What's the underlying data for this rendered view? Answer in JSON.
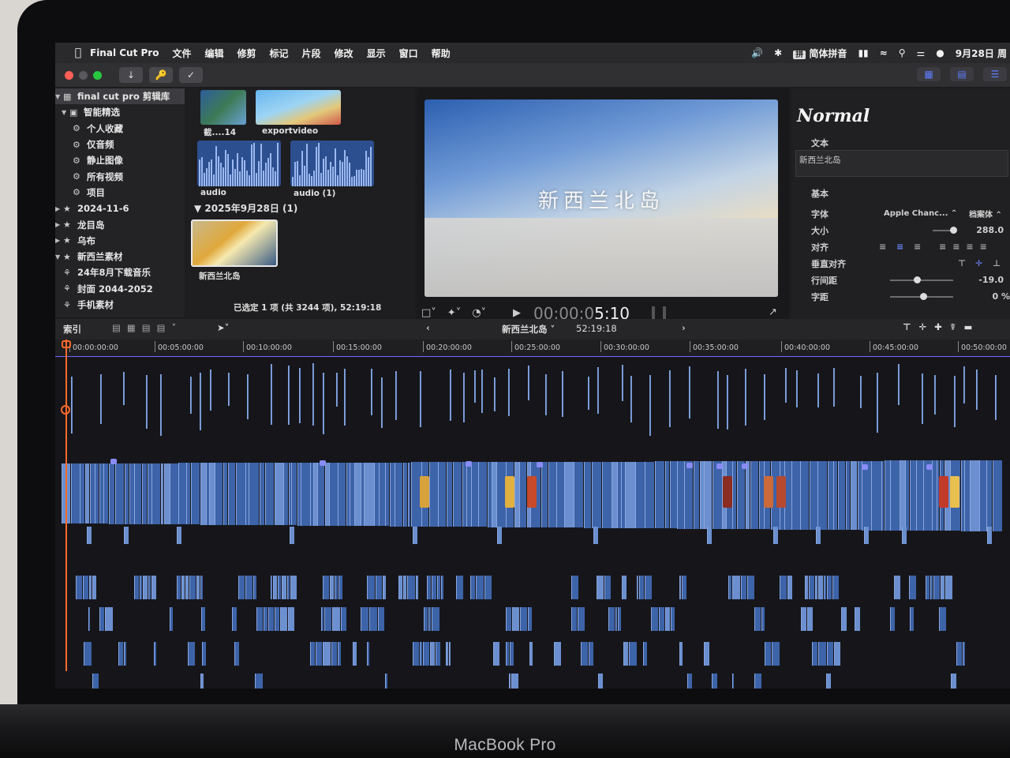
{
  "device": {
    "brand": "MacBook Pro"
  },
  "menubar": {
    "app_name": "Final Cut Pro",
    "items": [
      "文件",
      "编辑",
      "修剪",
      "标记",
      "片段",
      "修改",
      "显示",
      "窗口",
      "帮助"
    ],
    "input_method_badge": "拼",
    "input_method": "简体拼音",
    "date": "9月28日 周"
  },
  "sidebar": {
    "library": "final cut pro 剪辑库",
    "smart_collections_label": "智能精选",
    "smart_items": [
      "个人收藏",
      "仅音频",
      "静止图像",
      "所有视频",
      "项目"
    ],
    "events": [
      "2024-11-6",
      "龙目岛",
      "乌布",
      "新西兰素材"
    ],
    "sub_items": [
      "24年8月下载音乐",
      "封面 2044-2052",
      "手机素材"
    ]
  },
  "browser": {
    "clip_labels": [
      "截....14",
      "exportvideo",
      "audio",
      "audio (1)"
    ],
    "date_group": "2025年9月28日",
    "date_group_count": "(1)",
    "project_label": "新西兰北岛",
    "status": "已选定 1 项 (共 3244 项), 52:19:18"
  },
  "viewer": {
    "overlay_title": "新西兰北岛",
    "timecode_dim": "00:00:0",
    "timecode": "5:10"
  },
  "inspector": {
    "title": "Normal",
    "section_text": "文本",
    "text_value": "新西兰北岛",
    "section_basic": "基本",
    "rows": [
      {
        "key": "字体",
        "value": "Apple Chanc... ⌃",
        "extra": "档案体 ⌃"
      },
      {
        "key": "大小",
        "value": "288.0"
      },
      {
        "key": "对齐",
        "value": ""
      },
      {
        "key": "垂直对齐",
        "value": ""
      },
      {
        "key": "行间距",
        "value": "-19.0"
      },
      {
        "key": "字距",
        "value": "0 %"
      }
    ]
  },
  "timeline": {
    "index_label": "索引",
    "project_name": "新西兰北岛",
    "duration": "52:19:18",
    "ruler": [
      "00:00:00:00",
      "00:05:00:00",
      "00:10:00:00",
      "00:15:00:00",
      "00:20:00:00",
      "00:25:00:00",
      "00:30:00:00",
      "00:35:00:00",
      "00:40:00:00",
      "00:45:00:00",
      "00:50:00:00"
    ]
  },
  "colors": {
    "accent": "#5f7dff",
    "clip": "#3d63a8",
    "playhead": "#ff6a2c"
  }
}
